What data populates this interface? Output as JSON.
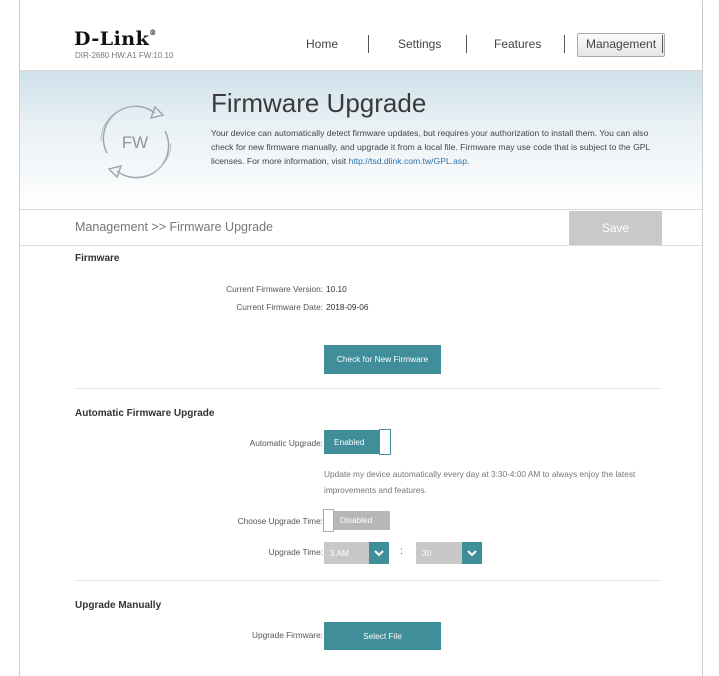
{
  "header": {
    "logo": "D-Link",
    "logo_mark": "®",
    "model_info": "DIR-2680 HW:A1 FW:10.10",
    "nav": [
      "Home",
      "Settings",
      "Features",
      "Management"
    ]
  },
  "banner": {
    "title": "Firmware Upgrade",
    "icon_label": "FW",
    "description": "Your device can automatically detect firmware updates, but requires your authorization to install them. You can also check for new firmware manually, and upgrade it from a local file. Firmware may use code that is subject to the GPL licenses. For more information, visit ",
    "link": "http://tsd.dlink.com.tw/GPL.asp",
    "link_suffix": "."
  },
  "breadcrumb": "Management >> Firmware Upgrade",
  "save_label": "Save",
  "firmware": {
    "title": "Firmware",
    "version_label": "Current Firmware Version:",
    "version_value": "10.10",
    "date_label": "Current Firmware Date:",
    "date_value": "2018-09-06",
    "check_button": "Check for New Firmware"
  },
  "auto": {
    "title": "Automatic Firmware Upgrade",
    "auto_label": "Automatic Upgrade:",
    "auto_state": "Enabled",
    "note": "Update my device automatically every day at 3:30-4:00 AM to always enjoy the latest improvements and features.",
    "choose_label": "Choose Upgrade Time:",
    "choose_state": "Disabled",
    "time_label": "Upgrade Time:",
    "hour_value": "3 AM",
    "colon": ":",
    "minute_value": "30"
  },
  "manual": {
    "title": "Upgrade Manually",
    "label": "Upgrade Firmware:",
    "button": "Select File"
  },
  "colors": {
    "accent": "#3f8e9a",
    "disabled": "#c8c8c8",
    "link": "#2f72a8"
  }
}
